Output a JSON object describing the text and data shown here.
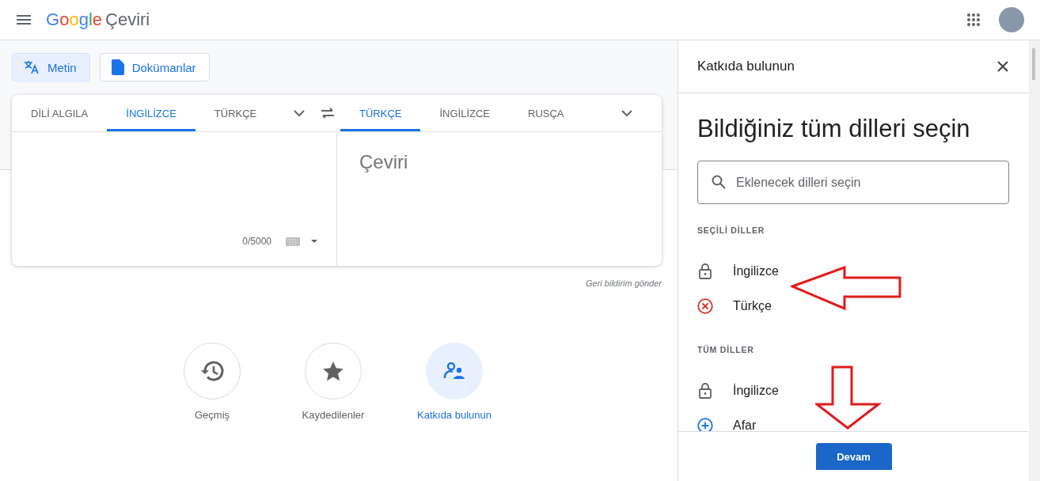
{
  "header": {
    "logo_brand": "Google",
    "logo_product": "Çeviri"
  },
  "mode_buttons": [
    {
      "label": "Metin",
      "kind": "text",
      "selected": true
    },
    {
      "label": "Dokümanlar",
      "kind": "document",
      "selected": false
    }
  ],
  "source_tabs": [
    {
      "label": "DİLİ ALGILA",
      "selected": false
    },
    {
      "label": "İNGİLİZCE",
      "selected": true
    },
    {
      "label": "TÜRKÇE",
      "selected": false
    }
  ],
  "target_tabs": [
    {
      "label": "TÜRKÇE",
      "selected": true
    },
    {
      "label": "İNGİLİZCE",
      "selected": false
    },
    {
      "label": "RUSÇA",
      "selected": false
    }
  ],
  "char_count": "0/5000",
  "translation_placeholder": "Çeviri",
  "feedback_link": "Geri bildirim gönder",
  "shortcuts": [
    {
      "label": "Geçmiş",
      "kind": "history",
      "selected": false
    },
    {
      "label": "Kaydedilenler",
      "kind": "saved",
      "selected": false
    },
    {
      "label": "Katkıda bulunun",
      "kind": "contribute",
      "selected": true
    }
  ],
  "panel": {
    "title": "Katkıda bulunun",
    "heading": "Bildiğiniz tüm dilleri seçin",
    "search_placeholder": "Eklenecek dilleri seçin",
    "sections": [
      {
        "title": "SEÇİLİ DİLLER",
        "languages": [
          {
            "name": "İngilizce",
            "kind": "locked"
          },
          {
            "name": "Türkçe",
            "kind": "remove"
          }
        ]
      },
      {
        "title": "TÜM DİLLER",
        "languages": [
          {
            "name": "İngilizce",
            "kind": "locked"
          },
          {
            "name": "Afar",
            "kind": "add"
          }
        ]
      }
    ],
    "button": "Devam"
  }
}
